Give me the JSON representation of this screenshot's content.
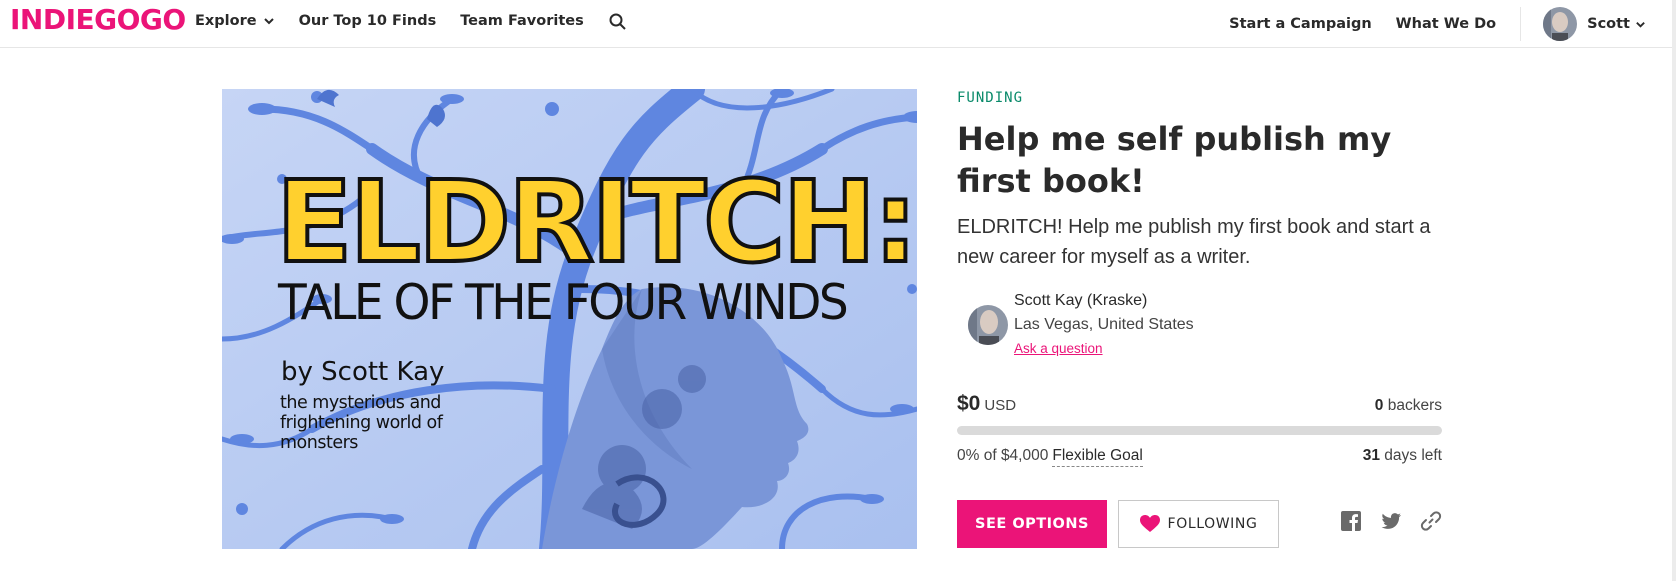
{
  "header": {
    "logo": "INDIEGOGO",
    "nav": {
      "explore": "Explore",
      "top10": "Our Top 10 Finds",
      "team_favorites": "Team Favorites"
    },
    "start_campaign": "Start a Campaign",
    "what_we_do": "What We Do",
    "user_name": "Scott"
  },
  "hero": {
    "title": "ELDRITCH:",
    "subtitle": "TALE OF THE FOUR WINDS",
    "author": "by Scott Kay",
    "tagline": "the mysterious and frightening world of monsters"
  },
  "campaign": {
    "status": "FUNDING",
    "title": "Help me self publish my first book!",
    "blurb": "ELDRITCH! Help me publish my first book and start a new career for myself as a writer.",
    "owner": {
      "name": "Scott Kay (Kraske)",
      "location": "Las Vegas, United States",
      "ask": "Ask a question"
    },
    "funding": {
      "amount": "$0",
      "currency": "USD",
      "backers_count": "0",
      "backers_label": "backers",
      "percent_text": "0% of $4,000",
      "progress_fraction": 0,
      "goal_type": "Flexible Goal",
      "days_count": "31",
      "days_label": "days left"
    },
    "actions": {
      "see_options": "SEE OPTIONS",
      "following": "FOLLOWING"
    }
  },
  "colors": {
    "brand": "#eb1478",
    "status": "#0a8a6a",
    "hero_blue": "#5f86e0",
    "hero_title": "#ffd02e"
  },
  "icons": [
    "search-icon",
    "chevron-down-icon",
    "heart-icon",
    "facebook-icon",
    "twitter-icon",
    "link-icon"
  ]
}
